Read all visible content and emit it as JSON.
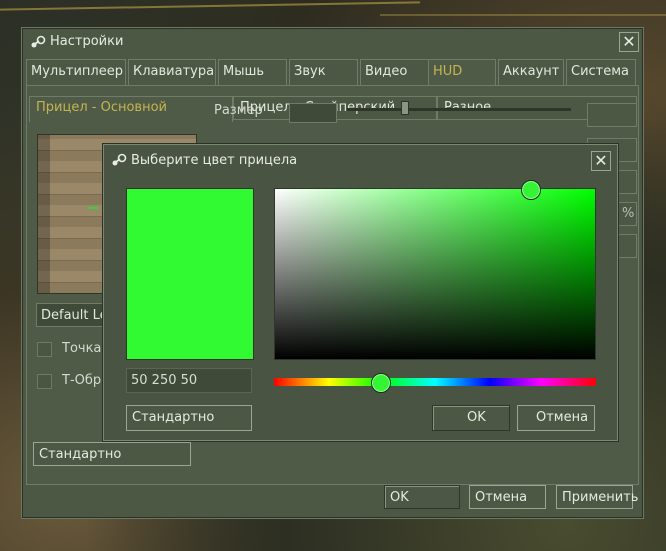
{
  "window": {
    "title": "Настройки",
    "tabs": [
      "Мультиплеер",
      "Клавиатура",
      "Мышь",
      "Звук",
      "Видео",
      "HUD",
      "Аккаунт",
      "Система"
    ],
    "active_tab": "HUD",
    "subtabs": [
      "Прицел - Основной",
      "Прицел - Снайперский",
      "Разное"
    ],
    "active_subtab": "Прицел - Основной",
    "size_label": "Размер",
    "dropdown_value": "Default Legacy",
    "checkbox_dot_label": "Точка по центру",
    "checkbox_t_label": "Т-Образный",
    "right_percent": "%",
    "default_button": "Стандартно",
    "ok_button": "OK",
    "cancel_button": "Отмена",
    "apply_button": "Применить"
  },
  "color_dialog": {
    "title": "Выберите цвет прицела",
    "rgb_value": "50 250 50",
    "default_button": "Стандартно",
    "ok_button": "OK",
    "cancel_button": "Отмена",
    "selected_color": "#32fa32",
    "hue_color": "#00ff00"
  },
  "colors": {
    "accent_text": "#c4b550",
    "panel_bg": "#4f5b47",
    "crosshair": "#35d335"
  },
  "icons": {
    "app_icon": "steam-icon",
    "close": "close-icon"
  }
}
